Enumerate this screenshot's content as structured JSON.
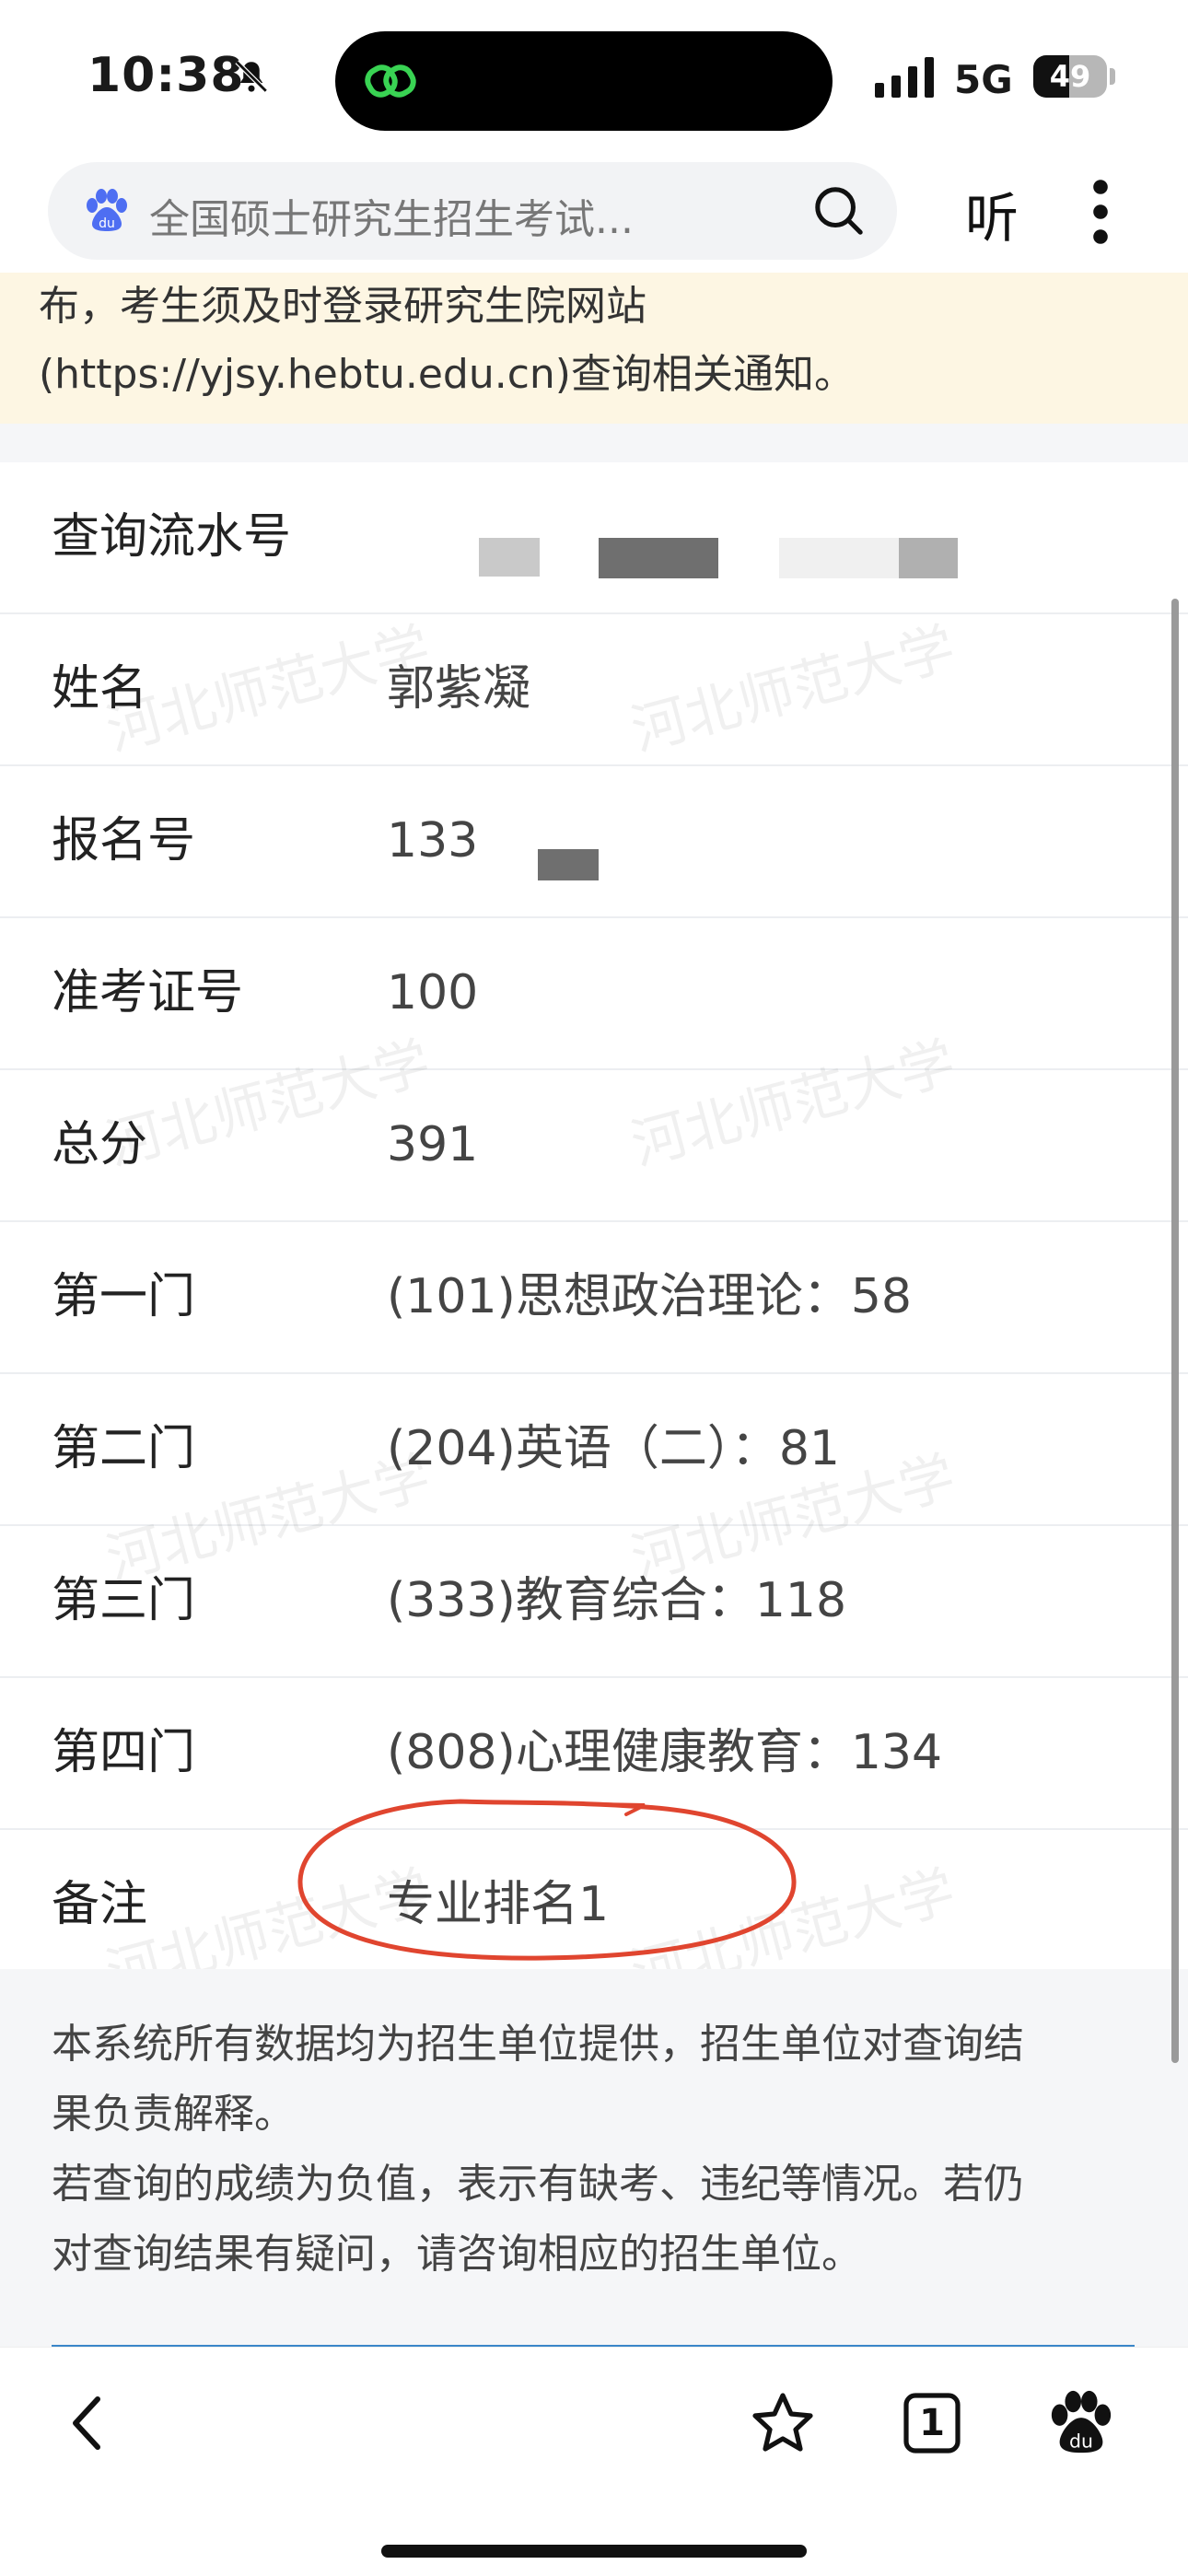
{
  "status_bar": {
    "time": "10:38",
    "network": "5G",
    "battery": "49",
    "battery_level": 0.49
  },
  "header": {
    "search_text": "全国硕士研究生招生考试...",
    "listen_label": "听",
    "icons": [
      "baidu-icon",
      "search-icon",
      "more-icon"
    ]
  },
  "notice": {
    "text": "布，考生须及时登录研究生院网站(https://yjsy.hebtu.edu.cn)查询相关通知。"
  },
  "results": {
    "rows": [
      {
        "label": "查询流水号",
        "value": ""
      },
      {
        "label": "姓名",
        "value": "郭紫凝"
      },
      {
        "label": "报名号",
        "value": "133"
      },
      {
        "label": "准考证号",
        "value": "100"
      },
      {
        "label": "总分",
        "value": "391"
      },
      {
        "label": "第一门",
        "value": "(101)思想政治理论：58"
      },
      {
        "label": "第二门",
        "value": "(204)英语（二）：81"
      },
      {
        "label": "第三门",
        "value": "(333)教育综合：118"
      },
      {
        "label": "第四门",
        "value": "(808)心理健康教育：134"
      },
      {
        "label": "备注",
        "value": "专业排名1"
      }
    ],
    "watermark": "河北师范大学"
  },
  "footnote": {
    "line1": "本系统所有数据均为招生单位提供，招生单位对查询结",
    "line2": "果负责解释。",
    "line3": "若查询的成绩为负值，表示有缺考、违纪等情况。若仍",
    "line4": "对查询结果有疑问，请咨询相应的招生单位。"
  },
  "bottom_bar": {
    "tab_count": "1",
    "icons": [
      "back-icon",
      "star-icon",
      "tabs-icon",
      "baidu-paw-icon"
    ]
  },
  "colors": {
    "annotation_red": "#e0452f",
    "notice_bg": "#fdf6e3",
    "link_blue": "#3a86c9"
  }
}
